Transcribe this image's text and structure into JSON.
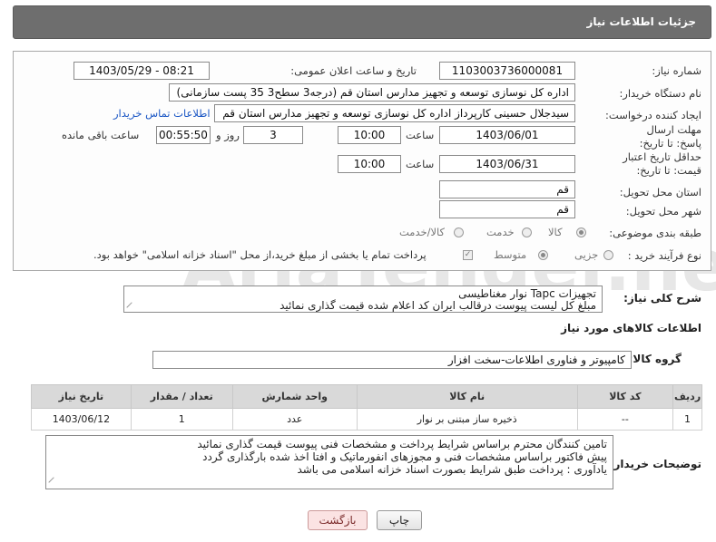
{
  "header": {
    "title": "جزئیات اطلاعات نیاز"
  },
  "form": {
    "need_number_label": "شماره نیاز:",
    "need_number": "1103003736000081",
    "announce_label": "تاریخ و ساعت اعلان عمومی:",
    "announce_value": "1403/05/29 - 08:21",
    "buyer_label": "نام دستگاه خریدار:",
    "buyer_value": "اداره کل نوسازی   توسعه و تجهیز مدارس استان قم (درجه3 سطح3  35 پست سازمانی)",
    "creator_label": "ایجاد کننده درخواست:",
    "creator_value": "سیدجلال حسینی کارپرداز اداره کل نوسازی   توسعه و تجهیز مدارس استان قم",
    "contact_link": "اطلاعات تماس خریدار",
    "reply_deadline_label": "مهلت ارسال پاسخ: تا تاریخ:",
    "reply_date": "1403/06/01",
    "time_label": "ساعت",
    "reply_time": "10:00",
    "days_value": "3",
    "days_label": "روز و",
    "remaining_time": "00:55:50",
    "remaining_label": "ساعت باقی مانده",
    "validity_label": "حداقل تاریخ اعتبار قیمت: تا تاریخ:",
    "validity_date": "1403/06/31",
    "validity_time": "10:00",
    "province_label": "استان محل تحویل:",
    "province_value": "قم",
    "city_label": "شهر محل تحویل:",
    "city_value": "قم",
    "category_label": "طبقه بندی موضوعی:",
    "category_options": [
      "کالا",
      "خدمت",
      "کالا/خدمت"
    ],
    "process_label": "نوع فرآیند خرید :",
    "process_options": [
      "جزیی",
      "متوسط"
    ],
    "payment_note": "پرداخت تمام یا بخشی از مبلغ خرید،از محل \"اسناد خزانه اسلامی\" خواهد بود."
  },
  "description": {
    "label": "شرح کلی نیاز:",
    "line1": "تجهیزات Tapc نوار مغناطیسی",
    "line2": "مبلغ کل لیست پیوست درقالب ایران کد اعلام شده قیمت گذاری نمائید"
  },
  "goods_info": {
    "title": "اطلاعات کالاهای مورد نیاز",
    "group_label": "گروه کالا:",
    "group_value": "کامپیوتر و فناوری اطلاعات-سخت افزار",
    "columns": [
      "ردیف",
      "کد کالا",
      "نام کالا",
      "واحد شمارش",
      "تعداد / مقدار",
      "تاریخ نیاز"
    ],
    "rows": [
      {
        "index": "1",
        "code": "--",
        "name": "ذخیره ساز مبتنی بر نوار",
        "unit": "عدد",
        "qty": "1",
        "date": "1403/06/12"
      }
    ]
  },
  "buyer_notes": {
    "label": "توضیحات خریدار:",
    "line1": "تامین کنندگان محترم براساس شرایط پرداخت و مشخصات فنی پیوست قیمت گذاری نمائید",
    "line2": "پیش فاکتور براساس مشخصات فنی و مجوزهای انفورماتیک و افتا اخذ شده بارگذاری گردد",
    "line3": "یادآوری : پرداخت طبق شرایط بصورت اسناد خزانه اسلامی می باشد"
  },
  "buttons": {
    "print": "چاپ",
    "back": "بازگشت"
  },
  "watermark": {
    "text": "AriaTender.neT"
  }
}
